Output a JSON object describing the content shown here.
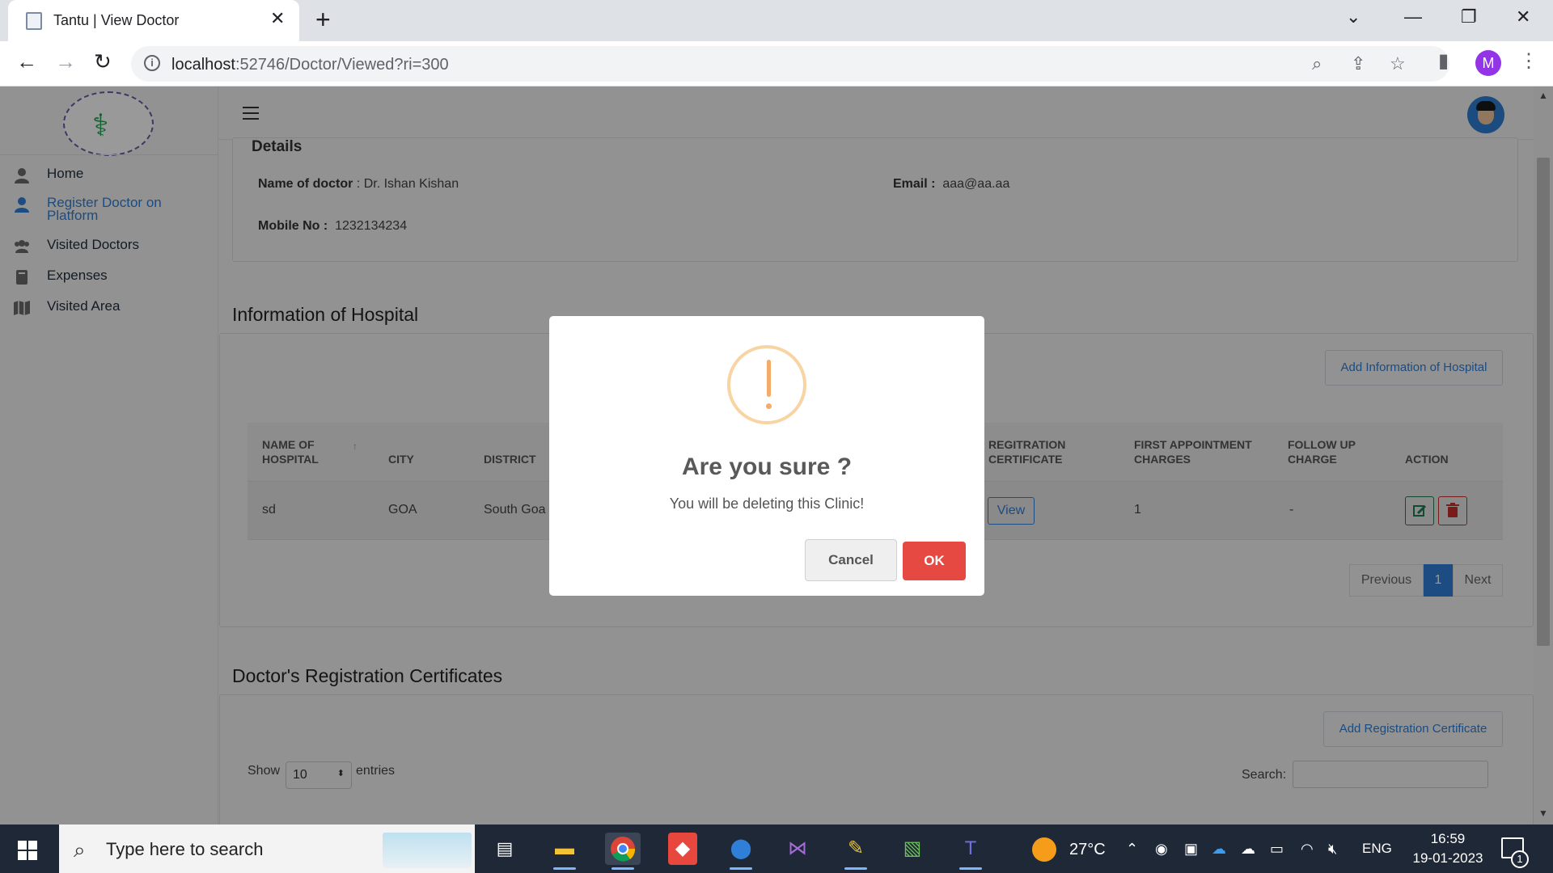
{
  "browser": {
    "tab_title": "Tantu | View Doctor",
    "url_host": "localhost",
    "url_path": ":52746/Doctor/Viewed?ri=300",
    "profile_initial": "M"
  },
  "sidebar": {
    "items": [
      {
        "label": "Home",
        "icon": "user-icon"
      },
      {
        "label": "Register Doctor on Platform",
        "icon": "doctor-icon"
      },
      {
        "label": "Visited Doctors",
        "icon": "users-icon"
      },
      {
        "label": "Expenses",
        "icon": "book-icon"
      },
      {
        "label": "Visited Area",
        "icon": "map-icon"
      }
    ]
  },
  "details": {
    "heading": "Details",
    "name_label": "Name of doctor",
    "name_value": ": Dr. Ishan Kishan",
    "email_label": "Email :",
    "email_value": "aaa@aa.aa",
    "mobile_label": "Mobile No :",
    "mobile_value": "1232134234"
  },
  "hospital": {
    "title": "Information of Hospital",
    "add_button": "Add Information of Hospital",
    "columns": [
      "NAME OF HOSPITAL",
      "CITY",
      "DISTRICT",
      "REGITRATION CERTIFICATE",
      "FIRST APPOINTMENT CHARGES",
      "FOLLOW UP CHARGE",
      "ACTION"
    ],
    "rows": [
      {
        "name": "sd",
        "city": "GOA",
        "district": "South Goa",
        "certificate": "View",
        "first_charge": "1",
        "follow_up": "-"
      }
    ],
    "pagination": {
      "previous": "Previous",
      "current": "1",
      "next": "Next"
    }
  },
  "certificates": {
    "title": "Doctor's Registration Certificates",
    "add_button": "Add Registration Certificate",
    "show_label": "Show",
    "entries_value": "10",
    "entries_label": "entries",
    "search_label": "Search:"
  },
  "modal": {
    "title": "Are you sure ?",
    "text": "You will be deleting this Clinic!",
    "cancel": "Cancel",
    "ok": "OK",
    "accent": "#e64942",
    "warning_color": "#f5ab6a"
  },
  "taskbar": {
    "search_placeholder": "Type here to search",
    "temperature": "27°C",
    "language": "ENG",
    "time": "16:59",
    "date": "19-01-2023",
    "notifications": "1"
  }
}
